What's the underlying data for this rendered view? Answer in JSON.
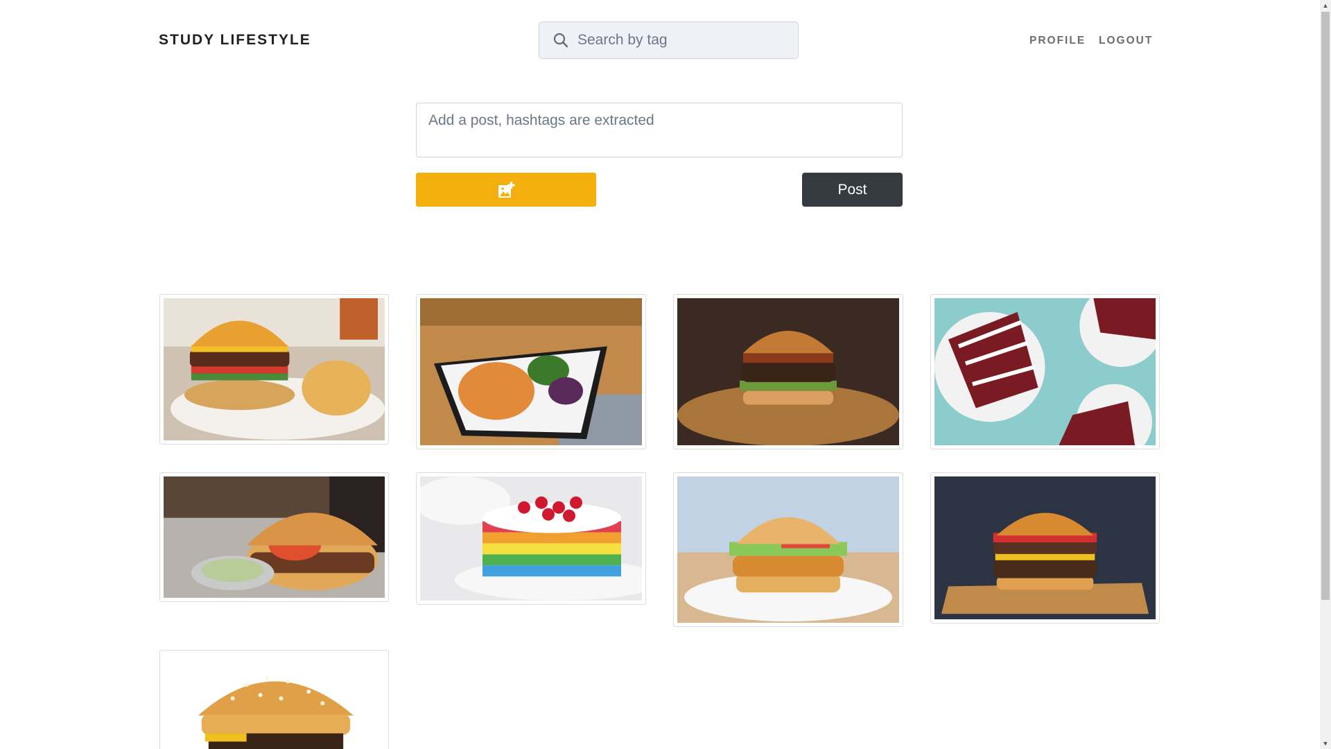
{
  "header": {
    "brand": "STUDY LIFESTYLE",
    "search_placeholder": "Search by tag",
    "nav": {
      "profile": "PROFILE",
      "logout": "LOGOUT"
    }
  },
  "composer": {
    "placeholder": "Add a post, hashtags are extracted",
    "upload_icon": "add-photo-icon",
    "post_label": "Post"
  },
  "colors": {
    "upload_button": "#f3b00c",
    "post_button": "#343a40",
    "search_background": "#eef1f5"
  },
  "posts": [
    {
      "subject": "burger with fries"
    },
    {
      "subject": "roasted cauliflower plate"
    },
    {
      "subject": "burger on wooden board"
    },
    {
      "subject": "red velvet cake slices"
    },
    {
      "subject": "burger with dipping sauce"
    },
    {
      "subject": "rainbow layer cake with raspberries"
    },
    {
      "subject": "crispy chicken burger"
    },
    {
      "subject": "bacon cheeseburger"
    },
    {
      "subject": "sesame bun burger"
    }
  ]
}
